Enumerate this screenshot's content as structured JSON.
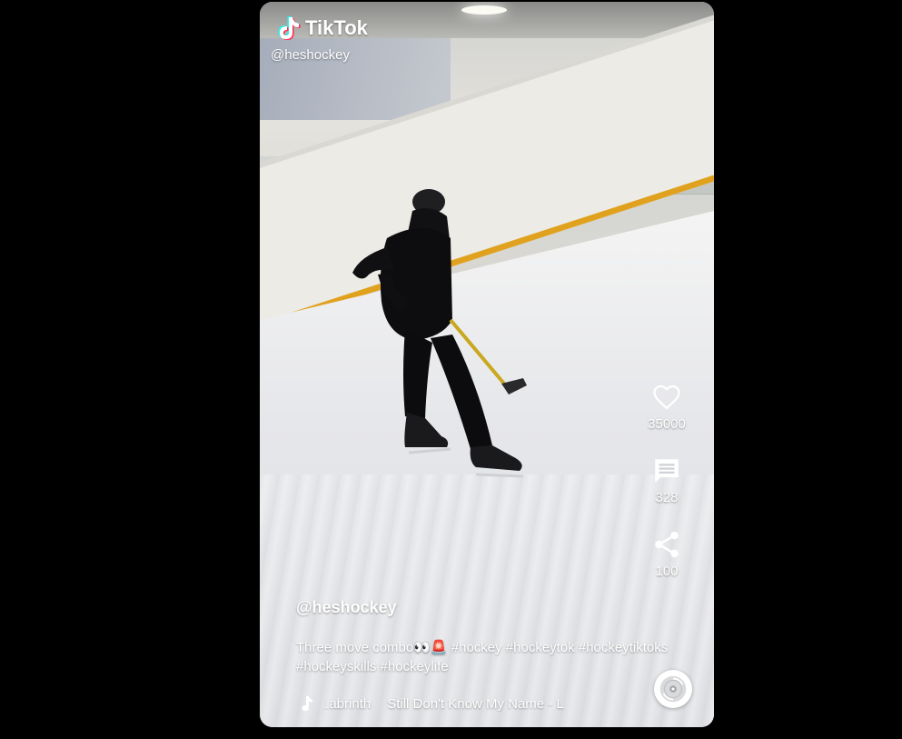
{
  "brand": {
    "name": "TikTok",
    "handle": "@heshockey"
  },
  "actions": {
    "likes": "35000",
    "comments": "328",
    "shares": "100"
  },
  "post": {
    "author": "@heshockey",
    "caption_text": "Three move combo",
    "caption_emoji": "👀🚨",
    "hashtags_line1": "#hockey #hockeytok #hockeytiktoks",
    "hashtags_line2": "#hockeyskills #hockeylife"
  },
  "music": {
    "artist": "Labrinth",
    "title": "Still Don't Know My Name - L"
  },
  "icons": {
    "brand": "tiktok-logo-icon",
    "like": "heart-icon",
    "comment": "comment-icon",
    "share": "share-icon",
    "music": "music-note-icon",
    "disc": "disc-icon"
  }
}
